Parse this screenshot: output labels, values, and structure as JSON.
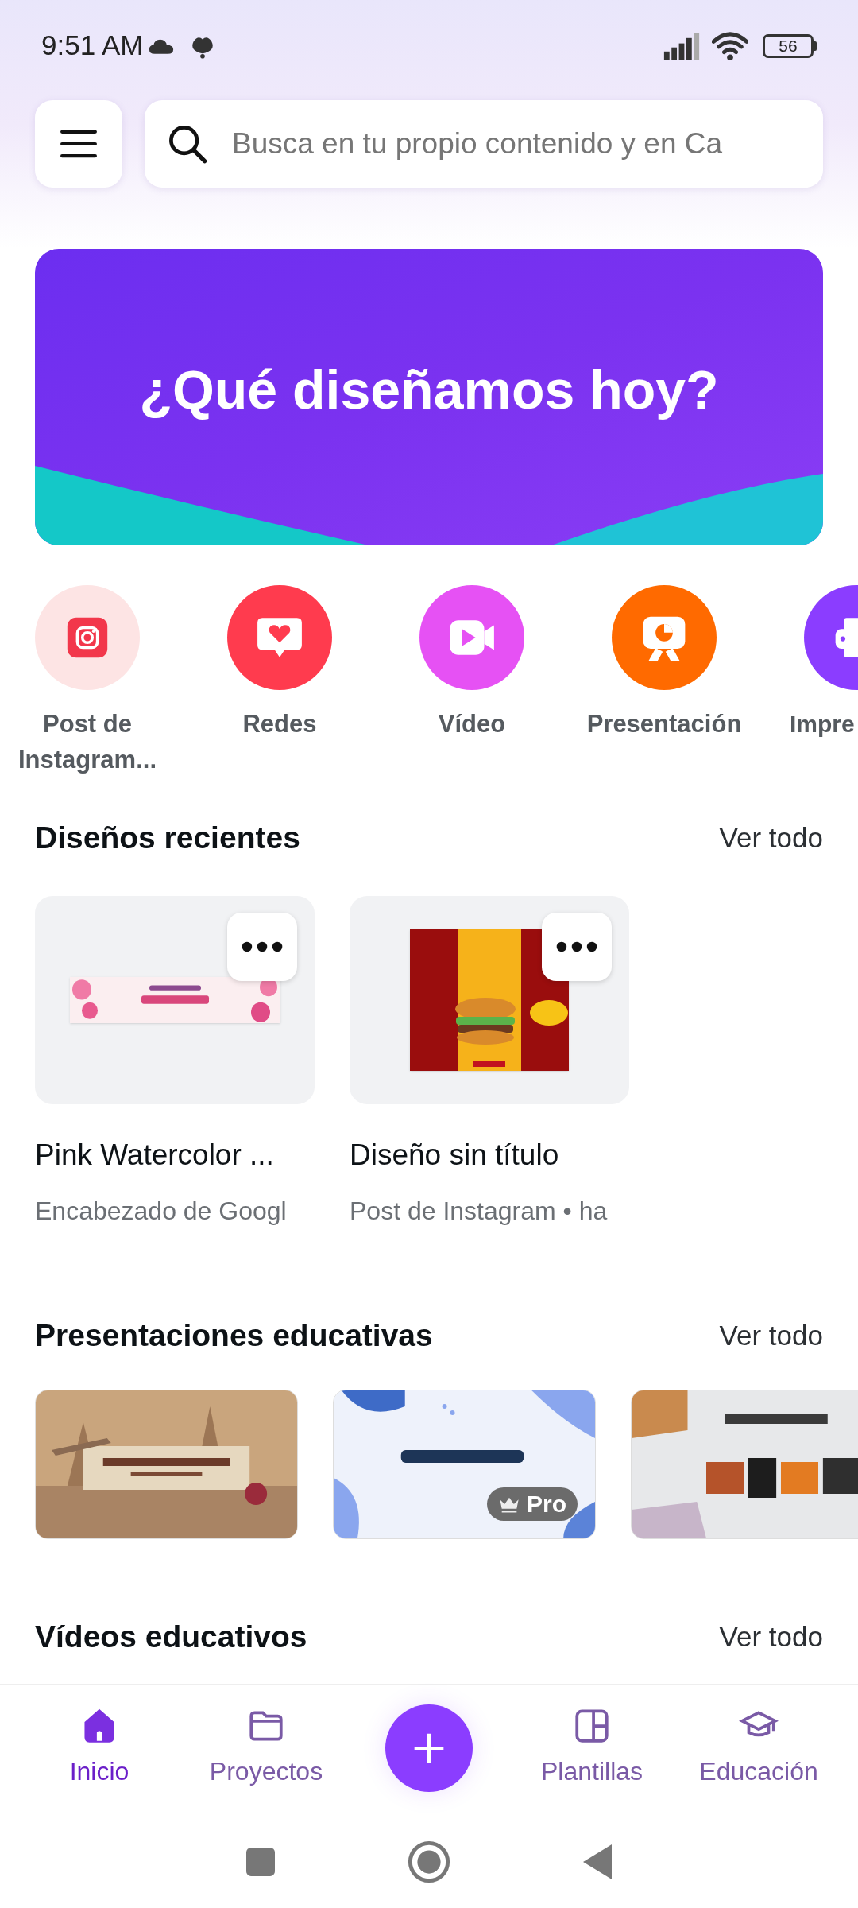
{
  "status_bar": {
    "time": "9:51 AM",
    "battery": "56"
  },
  "search": {
    "placeholder": "Busca en tu propio contenido y en Ca"
  },
  "banner": {
    "title": "¿Qué diseñamos hoy?"
  },
  "categories": [
    {
      "label": "Post de Instagram...",
      "color": "#fde4e4"
    },
    {
      "label": "Redes",
      "color": "#ff3b4e"
    },
    {
      "label": "Vídeo",
      "color": "#e651f4"
    },
    {
      "label": "Presentación",
      "color": "#ff6a00"
    },
    {
      "label": "Impre",
      "color": "#8b3dff"
    }
  ],
  "recent": {
    "title": "Diseños recientes",
    "link": "Ver todo",
    "items": [
      {
        "title": "Pink Watercolor ...",
        "subtitle": "Encabezado de Googl"
      },
      {
        "title": "Diseño sin título",
        "subtitle": "Post de Instagram • ha"
      }
    ]
  },
  "presentations": {
    "title": "Presentaciones educativas",
    "link": "Ver todo",
    "items": [
      {
        "kind": "picture"
      },
      {
        "kind": "picture",
        "badge": "Pro"
      },
      {
        "kind": "picture"
      }
    ]
  },
  "videos": {
    "title": "Vídeos educativos",
    "link": "Ver todo"
  },
  "bottom_nav": [
    {
      "label": "Inicio",
      "selected": true
    },
    {
      "label": "Proyectos",
      "selected": false
    },
    {
      "label": "Plantillas",
      "selected": false
    },
    {
      "label": "Educación",
      "selected": false
    }
  ]
}
